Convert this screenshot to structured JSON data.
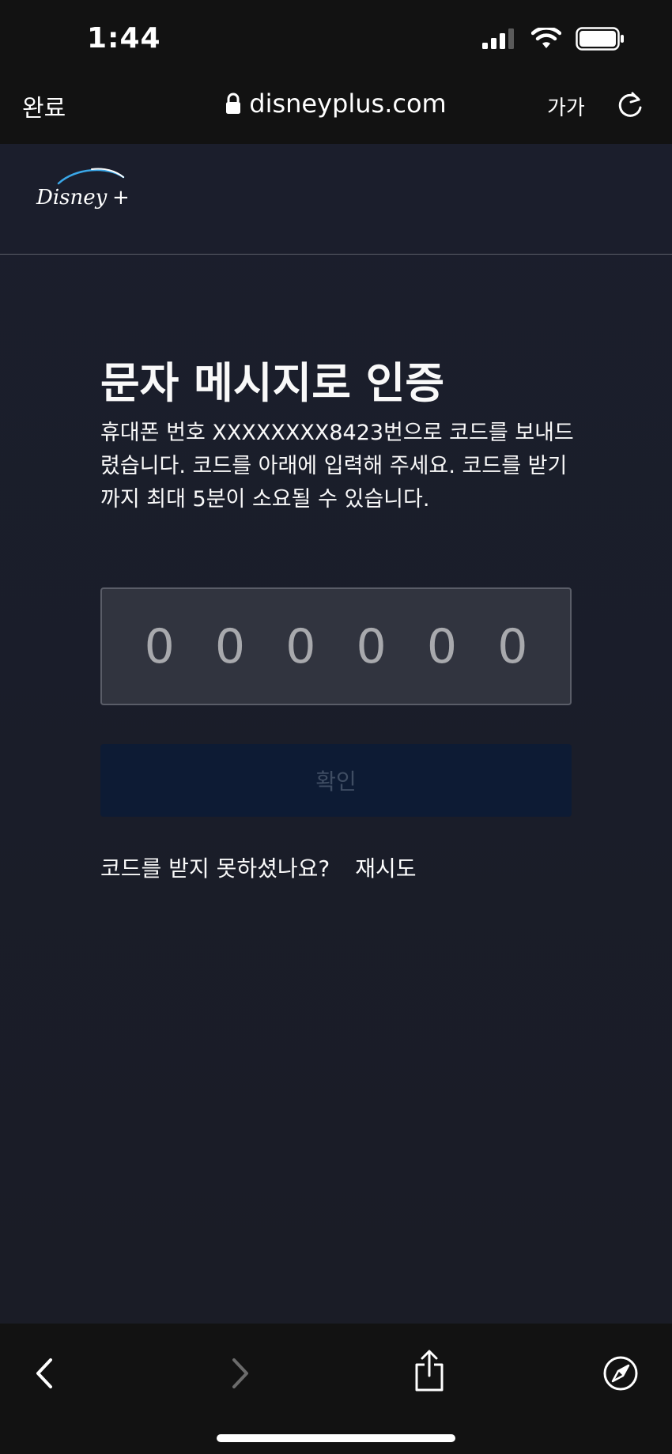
{
  "status_bar": {
    "time": "1:44"
  },
  "browser": {
    "done_label": "완료",
    "url": "disneyplus.com",
    "text_size_label": "가가"
  },
  "page": {
    "brand": "Disney+",
    "title": "문자 메시지로 인증",
    "description": "휴대폰 번호 XXXXXXXX8423번으로 코드를 보내드렸습니다. 코드를 아래에 입력해 주세요. 코드를 받기까지 최대 5분이 소요될 수 있습니다.",
    "code_digits": [
      "0",
      "0",
      "0",
      "0",
      "0",
      "0"
    ],
    "confirm_label": "확인",
    "resend_prompt": "코드를 받지 못하셨나요?",
    "retry_label": "재시도"
  },
  "icons": {
    "lock": "lock-icon",
    "reload": "reload-icon",
    "back": "chevron-left-icon",
    "forward": "chevron-right-icon",
    "share": "share-icon",
    "compass": "compass-icon"
  },
  "colors": {
    "page_background": "#1a1d29",
    "button_disabled_bg": "#0d1b34",
    "button_disabled_text": "#3f4d63",
    "code_box_bg": "#31343f"
  }
}
